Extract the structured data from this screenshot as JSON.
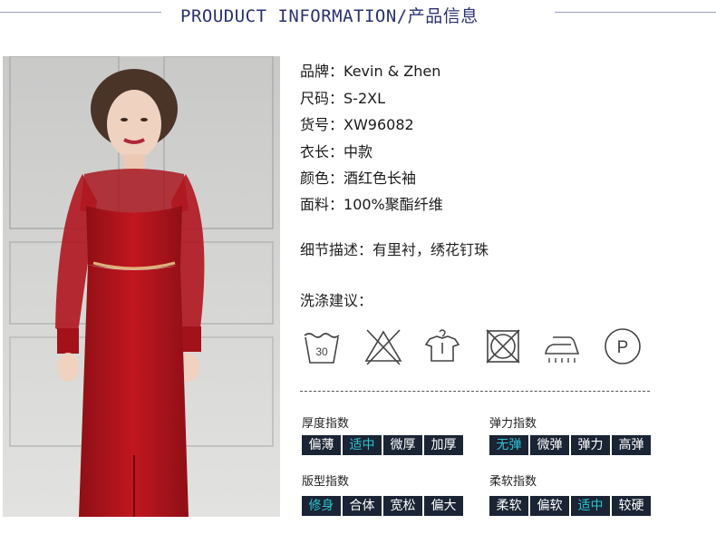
{
  "header": {
    "title": "PROUDUCT INFORMATION/产品信息"
  },
  "specs": [
    {
      "label": "品牌：",
      "value": "Kevin & Zhen"
    },
    {
      "label": "尺码：",
      "value": "S-2XL"
    },
    {
      "label": "货号：",
      "value": "XW96082"
    },
    {
      "label": "衣长：",
      "value": "中款"
    },
    {
      "label": "颜色：",
      "value": "酒红色长袖"
    },
    {
      "label": "面料：",
      "value": "100%聚酯纤维"
    }
  ],
  "detail": "细节描述：有里衬，绣花钉珠",
  "wash": {
    "title": "洗涤建议：",
    "wash_temp": "30",
    "dryclean_letter": "P",
    "icons": [
      "wash-30-icon",
      "do-not-bleach-icon",
      "hang-dry-icon",
      "do-not-tumble-dry-icon",
      "iron-steam-icon",
      "dry-clean-p-icon"
    ]
  },
  "indices": {
    "thickness": {
      "label": "厚度指数",
      "options": [
        "偏薄",
        "适中",
        "微厚",
        "加厚"
      ],
      "selected": 1
    },
    "elasticity": {
      "label": "弹力指数",
      "options": [
        "无弹",
        "微弹",
        "弹力",
        "高弹"
      ],
      "selected": 0
    },
    "fit": {
      "label": "版型指数",
      "options": [
        "修身",
        "合体",
        "宽松",
        "偏大"
      ],
      "selected": 0
    },
    "softness": {
      "label": "柔软指数",
      "options": [
        "柔软",
        "偏软",
        "适中",
        "较硬"
      ],
      "selected": 2
    }
  },
  "colors": {
    "dress": "#b3141c",
    "chip_bg": "#1a2434",
    "chip_active": "#2fc3d2",
    "header": "#2a3270"
  }
}
